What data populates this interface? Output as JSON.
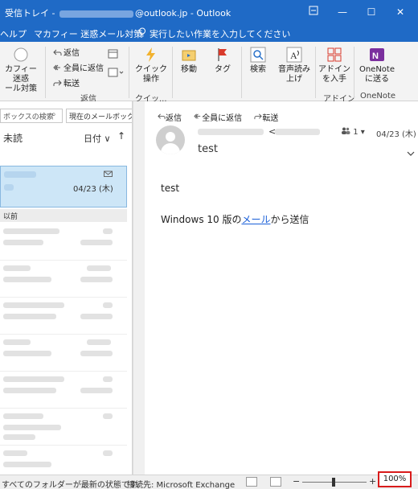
{
  "titlebar": {
    "prefix": "受信トレイ - ",
    "suffix": "@outlook.jp  -  Outlook",
    "restore_icon": "restore-icon",
    "minimize": "—",
    "maximize": "☐",
    "close": "✕"
  },
  "menubar": {
    "help": "ヘルプ",
    "mcafee": "マカフィー 迷惑メール対策",
    "tell_me": "実行したい作業を入力してください"
  },
  "ribbon": {
    "mcafee_btn": "カフィー 迷惑\nール対策",
    "reply": "返信",
    "reply_all": "全員に返信",
    "forward": "転送",
    "respond_group": "返信",
    "quick_steps": "クイック\n操作",
    "quick_group": "クイッ...",
    "move": "移動",
    "tags": "タグ",
    "find": "検索",
    "read_aloud": "音声読み\n上げ",
    "addins": "アドイン\nを入手",
    "addins_group": "アドイン",
    "onenote": "OneNote\nに送る",
    "onenote_group": "OneNote"
  },
  "list": {
    "search_placeholder": "ボックスの検索",
    "scope": "現在のメールボックス",
    "unread_tab": "未読",
    "sort": "日付 ∨",
    "sort_arrow": "↑",
    "selected_date": "04/23 (木)",
    "group_header": "以前"
  },
  "reading": {
    "reply": "返信",
    "reply_all": "全員に返信",
    "forward": "転送",
    "from_lt": "<",
    "people_count": "1",
    "date": "04/23 (木)",
    "subject": "test",
    "body_line1": "test",
    "body_prefix": "Windows 10 版の",
    "body_link": "メール",
    "body_suffix": "から送信"
  },
  "status": {
    "folders": "すべてのフォルダーが最新の状態です。",
    "connection": "接続先: Microsoft Exchange",
    "zoom_minus": "−",
    "zoom_plus": "+",
    "zoom_level": "100%"
  },
  "colors": {
    "titlebar": "#1f6ac6",
    "selection": "#cde6f7",
    "link": "#1a5fd8",
    "highlight_box": "#d91b1b"
  }
}
